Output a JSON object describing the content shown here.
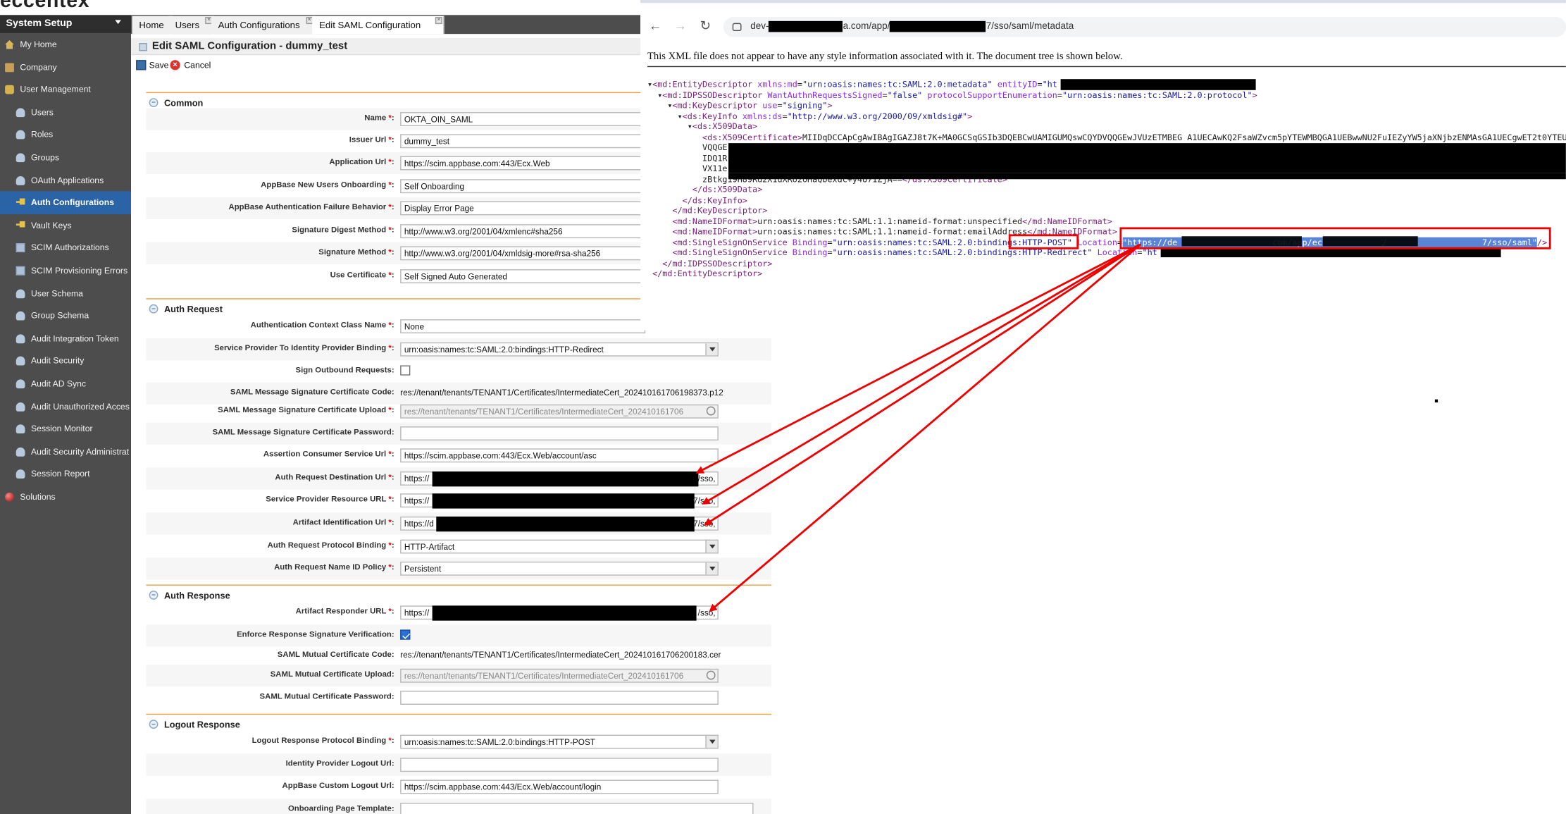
{
  "brand": {
    "logo": "eccentex"
  },
  "sidebar": {
    "header": "System Setup",
    "items": [
      {
        "label": "My Home",
        "icon": "home-icon"
      },
      {
        "label": "Company",
        "icon": "company-icon"
      },
      {
        "label": "User Management",
        "icon": "lock-icon"
      },
      {
        "label": "Users",
        "icon": "user-icon"
      },
      {
        "label": "Roles",
        "icon": "user-icon"
      },
      {
        "label": "Groups",
        "icon": "user-icon"
      },
      {
        "label": "OAuth Applications",
        "icon": "user-icon"
      },
      {
        "label": "Auth Configurations",
        "icon": "key-icon"
      },
      {
        "label": "Vault Keys",
        "icon": "key-icon"
      },
      {
        "label": "SCIM Authorizations",
        "icon": "box-icon"
      },
      {
        "label": "SCIM Provisioning Errors",
        "icon": "box-icon"
      },
      {
        "label": "User Schema",
        "icon": "user-icon"
      },
      {
        "label": "Group Schema",
        "icon": "user-icon"
      },
      {
        "label": "Audit Integration Token",
        "icon": "user-icon"
      },
      {
        "label": "Audit Security",
        "icon": "user-icon"
      },
      {
        "label": "Audit AD Sync",
        "icon": "user-icon"
      },
      {
        "label": "Audit Unauthorized Acces",
        "icon": "user-icon"
      },
      {
        "label": "Session Monitor",
        "icon": "user-icon"
      },
      {
        "label": "Audit Security Administrat",
        "icon": "user-icon"
      },
      {
        "label": "Session Report",
        "icon": "user-icon"
      },
      {
        "label": "Solutions",
        "icon": "globe-icon"
      }
    ]
  },
  "tabs": [
    {
      "label": "Home"
    },
    {
      "label": "Users"
    },
    {
      "label": "Auth Configurations"
    },
    {
      "label": "Edit SAML Configuration"
    }
  ],
  "page": {
    "title": "Edit SAML Configuration - dummy_test",
    "save": "Save",
    "cancel": "Cancel"
  },
  "sections": {
    "common": "Common",
    "auth_request": "Auth Request",
    "auth_response": "Auth Response",
    "logout_response": "Logout Response"
  },
  "fields": {
    "name": {
      "label": "Name",
      "value": "OKTA_OIN_SAML"
    },
    "issuer": {
      "label": "Issuer Url",
      "value": "dummy_test"
    },
    "app_url": {
      "label": "Application Url",
      "value": "https://scim.appbase.com:443/Ecx.Web"
    },
    "onboarding": {
      "label": "AppBase New Users Onboarding",
      "value": "Self Onboarding"
    },
    "auth_failure": {
      "label": "AppBase Authentication Failure Behavior",
      "value": "Display Error Page"
    },
    "digest": {
      "label": "Signature Digest Method",
      "value": "http://www.w3.org/2001/04/xmlenc#sha256"
    },
    "sig_method": {
      "label": "Signature Method",
      "value": "http://www.w3.org/2001/04/xmldsig-more#rsa-sha256"
    },
    "use_cert": {
      "label": "Use Certificate",
      "value": "Self Signed Auto Generated"
    },
    "auth_ctx": {
      "label": "Authentication Context Class Name",
      "value": "None"
    },
    "sp_idp_binding": {
      "label": "Service Provider To Identity Provider Binding",
      "value": "urn:oasis:names:tc:SAML:2.0:bindings:HTTP-Redirect"
    },
    "sign_outbound": {
      "label": "Sign Outbound Requests:"
    },
    "msg_cert_code": {
      "label": "SAML Message Signature Certificate Code:",
      "value": "res://tenant/tenants/TENANT1/Certificates/IntermediateCert_2024101617061​98373.p12"
    },
    "msg_cert_upload": {
      "label": "SAML Message Signature Certificate Upload",
      "value": "res://tenant/tenants/TENANT1/Certificates/IntermediateCert_202410161706"
    },
    "msg_cert_pwd": {
      "label": "SAML Message Signature Certificate Password:",
      "value": ""
    },
    "acs_url": {
      "label": "Assertion Consumer Service Url",
      "value": "https://scim.appbase.com:443/Ecx.Web/account/asc"
    },
    "dest_url": {
      "label": "Auth Request Destination Url",
      "value": "https://",
      "suffix": "7/sso,"
    },
    "sp_resource": {
      "label": "Service Provider Resource URL",
      "value": "https://",
      "suffix": "7/sso,"
    },
    "artifact_id": {
      "label": "Artifact Identification Url",
      "value": "https://d",
      "suffix": "7/sso,"
    },
    "req_binding": {
      "label": "Auth Request Protocol Binding",
      "value": "HTTP-Artifact"
    },
    "name_id": {
      "label": "Auth Request Name ID Policy",
      "value": "Persistent"
    },
    "artifact_resp": {
      "label": "Artifact Responder URL",
      "value": "https://",
      "suffix": "/sso,"
    },
    "enforce_sig": {
      "label": "Enforce Response Signature Verification:"
    },
    "mutual_code": {
      "label": "SAML Mutual Certificate Code:",
      "value": "res://tenant/tenants/TENANT1/Certificates/IntermediateCert_20241016170620018​3.cer"
    },
    "mutual_upload": {
      "label": "SAML Mutual Certificate Upload:",
      "value": "res://tenant/tenants/TENANT1/Certificates/IntermediateCert_202410161706"
    },
    "mutual_pwd": {
      "label": "SAML Mutual Certificate Password:",
      "value": ""
    },
    "logout_binding": {
      "label": "Logout Response Protocol Binding",
      "value": "urn:oasis:names:tc:SAML:2.0:bindings:HTTP-POST"
    },
    "idp_logout": {
      "label": "Identity Provider Logout Url:",
      "value": ""
    },
    "custom_logout": {
      "label": "AppBase Custom Logout Url:",
      "value": "https://scim.appbase.com:443/Ecx.Web/account/login"
    },
    "onboard_tpl": {
      "label": "Onboarding Page Template:"
    }
  },
  "browser": {
    "url_prefix": "dev-",
    "url_mid": "a.com/app/",
    "url_suffix": "7/sso/saml/metadata",
    "notice": "This XML file does not appear to have any style information associated with it. The document tree is shown below."
  },
  "colors": {
    "sidebar_bg": "#4d4d4d",
    "active": "#2a63a6",
    "section_rule": "#f0a040",
    "annotation": "#e00000"
  }
}
